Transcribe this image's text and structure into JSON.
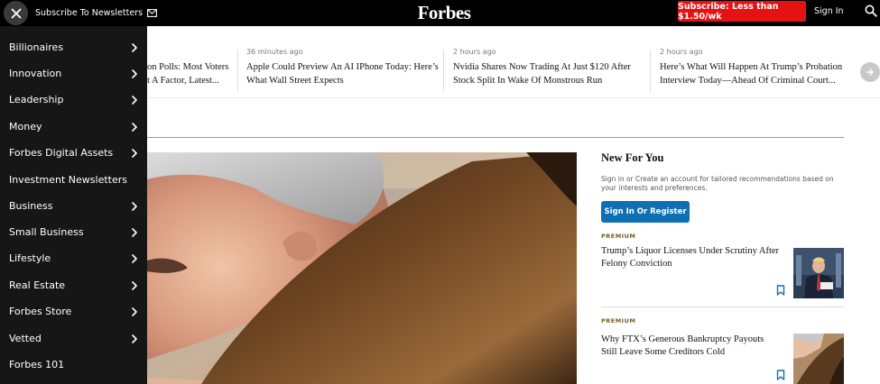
{
  "topbar": {
    "subscribe_newsletters": "Subscribe To Newsletters",
    "logo": "Forbes",
    "subscribe_button": "Subscribe: Less than $1.50/wk",
    "sign_in": "Sign In",
    "icons": [
      "close-icon",
      "mail-icon",
      "search-icon"
    ]
  },
  "ticker": {
    "items": [
      {
        "time": "",
        "title_line1": "on Polls: Most Voters",
        "title_line2": "t A Factor, Latest..."
      },
      {
        "time": "36 minutes ago",
        "title_line1": "Apple Could Preview An AI IPhone Today: Here’s",
        "title_line2": "What Wall Street Expects"
      },
      {
        "time": "2 hours ago",
        "title_line1": "Nvidia Shares Now Trading At Just $120 After",
        "title_line2": "Stock Split In Wake Of Monstrous Run"
      },
      {
        "time": "2 hours ago",
        "title_line1": "Here’s What Will Happen At Trump’s Probation",
        "title_line2": "Interview Today—Ahead Of Criminal Court..."
      }
    ]
  },
  "sidebar": {
    "items": [
      {
        "label": "Billionaires",
        "has_chevron": true
      },
      {
        "label": "Innovation",
        "has_chevron": true
      },
      {
        "label": "Leadership",
        "has_chevron": true
      },
      {
        "label": "Money",
        "has_chevron": true
      },
      {
        "label": "Forbes Digital Assets",
        "has_chevron": true
      },
      {
        "label": "Investment Newsletters",
        "has_chevron": false
      },
      {
        "label": "Business",
        "has_chevron": true
      },
      {
        "label": "Small Business",
        "has_chevron": true
      },
      {
        "label": "Lifestyle",
        "has_chevron": true
      },
      {
        "label": "Real Estate",
        "has_chevron": true
      },
      {
        "label": "Forbes Store",
        "has_chevron": true
      },
      {
        "label": "Vetted",
        "has_chevron": true
      },
      {
        "label": "Forbes 101",
        "has_chevron": false
      }
    ]
  },
  "new_for_you": {
    "title": "New For You",
    "description": "Sign in or Create an account for tailored recommendations based on your interests and preferences.",
    "button": "Sign In Or Register",
    "articles": [
      {
        "badge": "PREMIUM",
        "title": "Trump’s Liquor Licenses Under Scrutiny After Felony Conviction"
      },
      {
        "badge": "PREMIUM",
        "title": "Why FTX’s Generous Bankruptcy Payouts Still Leave Some Creditors Cold"
      }
    ]
  },
  "colors": {
    "brand_red": "#e41212",
    "register_blue": "#0f6fb3",
    "sidebar_bg": "#161616",
    "premium_gold": "#6f5e24"
  }
}
